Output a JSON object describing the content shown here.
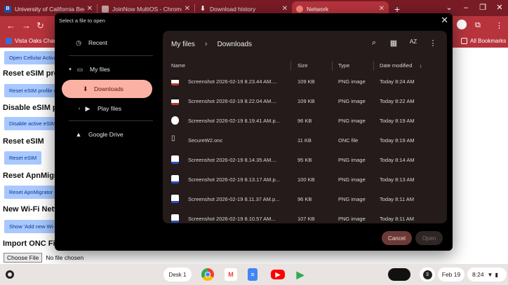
{
  "browser": {
    "tabs": [
      {
        "title": "University of California Berkeley",
        "favicon_letter": "B",
        "favicon_color": "#1d4fa6",
        "active": false
      },
      {
        "title": "JoinNow MultiOS - Chrome Web",
        "favicon_letter": "",
        "favicon_color": "#c9a6a6",
        "active": false
      },
      {
        "title": "Download history",
        "favicon_letter": "⬇",
        "favicon_color": "#7a1c26",
        "active": false
      },
      {
        "title": "Network",
        "favicon_letter": "",
        "favicon_color": "#ff8a7a",
        "active": true
      }
    ],
    "new_tab": "+",
    "window_controls": [
      "⌄",
      "–",
      "❐",
      "✕"
    ],
    "nav_icons": [
      "←",
      "→",
      "↻"
    ],
    "bookmarks": [
      {
        "label": "Vista Oaks Charter",
        "icon_color": "#3a6fd8"
      },
      {
        "label": "All Bookmarks",
        "icon_color": "#ffffff"
      }
    ],
    "accent_color": "#b8343d"
  },
  "page": {
    "buttons": [
      {
        "label": "Open Cellular Activat"
      },
      {
        "label": "Reset eSIM profile c"
      },
      {
        "label": "Disable active eSIM"
      },
      {
        "label": "Reset eSIM"
      },
      {
        "label": "Reset ApnMigrator"
      },
      {
        "label": "Show 'Add new Wi-Fi"
      }
    ],
    "headings": [
      "Reset eSIM prof",
      "Disable eSIM pr",
      "Reset eSIM",
      "Reset ApnMigrat",
      "New Wi-Fi Netw",
      "Import ONC File"
    ],
    "file_input": {
      "button_label": "Choose File",
      "status": "No file chosen"
    }
  },
  "dialog": {
    "title": "Select a file to open",
    "close_icon": "✕",
    "sidebar": {
      "recent": "Recent",
      "my_files": "My files",
      "downloads": "Downloads",
      "play_files": "Play files",
      "google_drive": "Google Drive"
    },
    "breadcrumb": {
      "root": "My files",
      "current": "Downloads"
    },
    "columns": {
      "name": "Name",
      "size": "Size",
      "type": "Type",
      "date": "Date modified",
      "sort_icon": "↓"
    },
    "files": [
      {
        "name": "Screenshot 2026-02-19 8.23.44 AM....",
        "size": "109 KB",
        "type": "PNG image",
        "date": "Today 8:24 AM",
        "icon": "image-red"
      },
      {
        "name": "Screenshot 2026-02-19 8.22.04 AM....",
        "size": "109 KB",
        "type": "PNG image",
        "date": "Today 8:22 AM",
        "icon": "image-red"
      },
      {
        "name": "Screenshot 2026-02-19 8.19.41 AM.p...",
        "size": "96 KB",
        "type": "PNG image",
        "date": "Today 8:19 AM",
        "icon": "image-white"
      },
      {
        "name": "SecureW2.onc",
        "size": "11 KB",
        "type": "ONC file",
        "date": "Today 8:19 AM",
        "icon": "document"
      },
      {
        "name": "Screenshot 2026-02-19 8.14.35 AM....",
        "size": "95 KB",
        "type": "PNG image",
        "date": "Today 8:14 AM",
        "icon": "image-blue"
      },
      {
        "name": "Screenshot 2026-02-19 8.13.17 AM.p...",
        "size": "100 KB",
        "type": "PNG image",
        "date": "Today 8:13 AM",
        "icon": "image-blue"
      },
      {
        "name": "Screenshot 2026-02-19 8.11.37 AM.p...",
        "size": "96 KB",
        "type": "PNG image",
        "date": "Today 8:11 AM",
        "icon": "image-blue"
      },
      {
        "name": "Screenshot 2026-02-19 8.10.57 AM...",
        "size": "107 KB",
        "type": "PNG image",
        "date": "Today 8:11 AM",
        "icon": "image-blue"
      }
    ],
    "cancel_label": "Cancel",
    "open_label": "Open"
  },
  "shelf": {
    "desk_label": "Desk 1",
    "notification_count": "3",
    "date": "Feb 19",
    "time": "8:24"
  }
}
